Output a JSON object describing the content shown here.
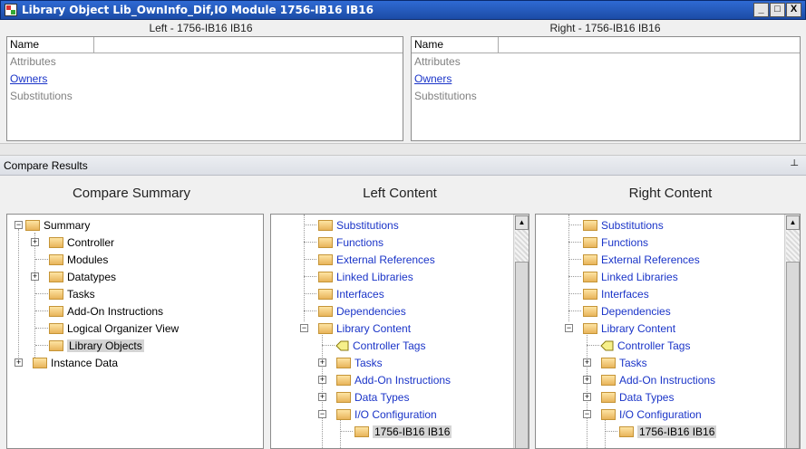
{
  "window": {
    "title": "Library Object Lib_OwnInfo_Dif,IO Module 1756-IB16 IB16",
    "min": "_",
    "max": "□",
    "close": "X"
  },
  "panes": {
    "left_title": "Left - 1756-IB16 IB16",
    "right_title": "Right - 1756-IB16 IB16",
    "name_header": "Name",
    "rows": [
      "Attributes",
      "Owners",
      "Substitutions"
    ]
  },
  "compare_results": {
    "label": "Compare Results"
  },
  "columns": {
    "summary": "Compare Summary",
    "left": "Left Content",
    "right": "Right Content"
  },
  "summary_tree": {
    "root": "Summary",
    "items": [
      "Controller",
      "Modules",
      "Datatypes",
      "Tasks",
      "Add-On Instructions",
      "Logical Organizer View",
      "Library Objects",
      "Instance Data"
    ]
  },
  "content_tree": {
    "items": [
      "Substitutions",
      "Functions",
      "External References",
      "Linked Libraries",
      "Interfaces",
      "Dependencies",
      "Library Content",
      "Controller Tags",
      "Tasks",
      "Add-On Instructions",
      "Data Types",
      "I/O Configuration",
      "1756-IB16 IB16"
    ]
  },
  "colors": {
    "link_blue": "#1a34c8",
    "title_bar": "#2f6ad3",
    "selection": "#d4d4d4"
  },
  "icons": {
    "folder": "folder-icon",
    "tag": "tag-icon",
    "pin": "pin-icon"
  }
}
